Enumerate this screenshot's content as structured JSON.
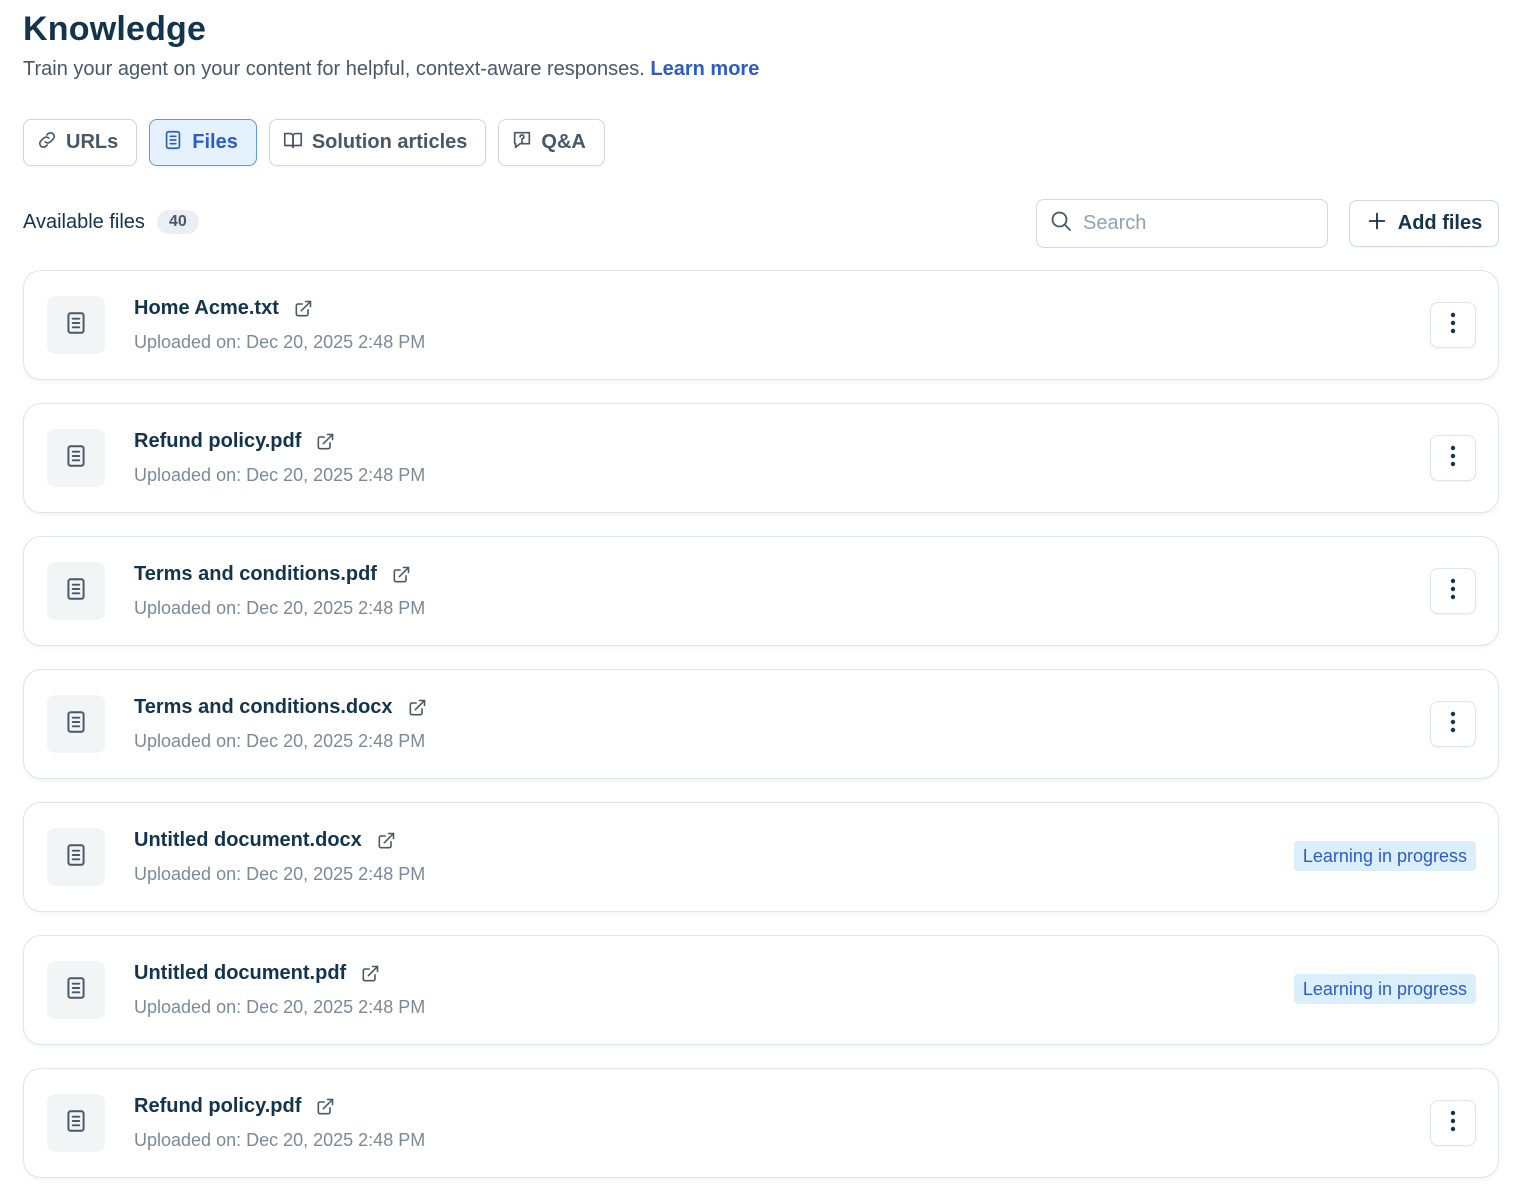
{
  "header": {
    "title": "Knowledge",
    "subtitle": "Train your agent on your content for helpful, context-aware responses.",
    "learn_more": "Learn more"
  },
  "tabs": [
    {
      "label": "URLs",
      "icon": "link-icon",
      "active": false
    },
    {
      "label": "Files",
      "icon": "document-icon",
      "active": true
    },
    {
      "label": "Solution articles",
      "icon": "book-icon",
      "active": false
    },
    {
      "label": "Q&A",
      "icon": "question-chat-icon",
      "active": false
    }
  ],
  "toolbar": {
    "label": "Available files",
    "count": "40",
    "search_placeholder": "Search",
    "add_label": "Add files"
  },
  "files": [
    {
      "name": "Home Acme.txt",
      "meta": "Uploaded on: Dec 20, 2025 2:48 PM",
      "status": ""
    },
    {
      "name": "Refund policy.pdf",
      "meta": "Uploaded on: Dec 20, 2025 2:48 PM",
      "status": ""
    },
    {
      "name": "Terms and conditions.pdf",
      "meta": "Uploaded on: Dec 20, 2025 2:48 PM",
      "status": ""
    },
    {
      "name": "Terms and conditions.docx",
      "meta": "Uploaded on: Dec 20, 2025 2:48 PM",
      "status": ""
    },
    {
      "name": "Untitled document.docx",
      "meta": "Uploaded on: Dec 20, 2025 2:48 PM",
      "status": "Learning in progress"
    },
    {
      "name": "Untitled document.pdf",
      "meta": "Uploaded on: Dec 20, 2025 2:48 PM",
      "status": "Learning in progress"
    },
    {
      "name": "Refund policy.pdf",
      "meta": "Uploaded on: Dec 20, 2025 2:48 PM",
      "status": ""
    }
  ],
  "colors": {
    "primary_text": "#12344d",
    "link": "#2c5cc5",
    "active_tab_bg": "#e5f2fd",
    "status_bg": "#dbeefb"
  }
}
